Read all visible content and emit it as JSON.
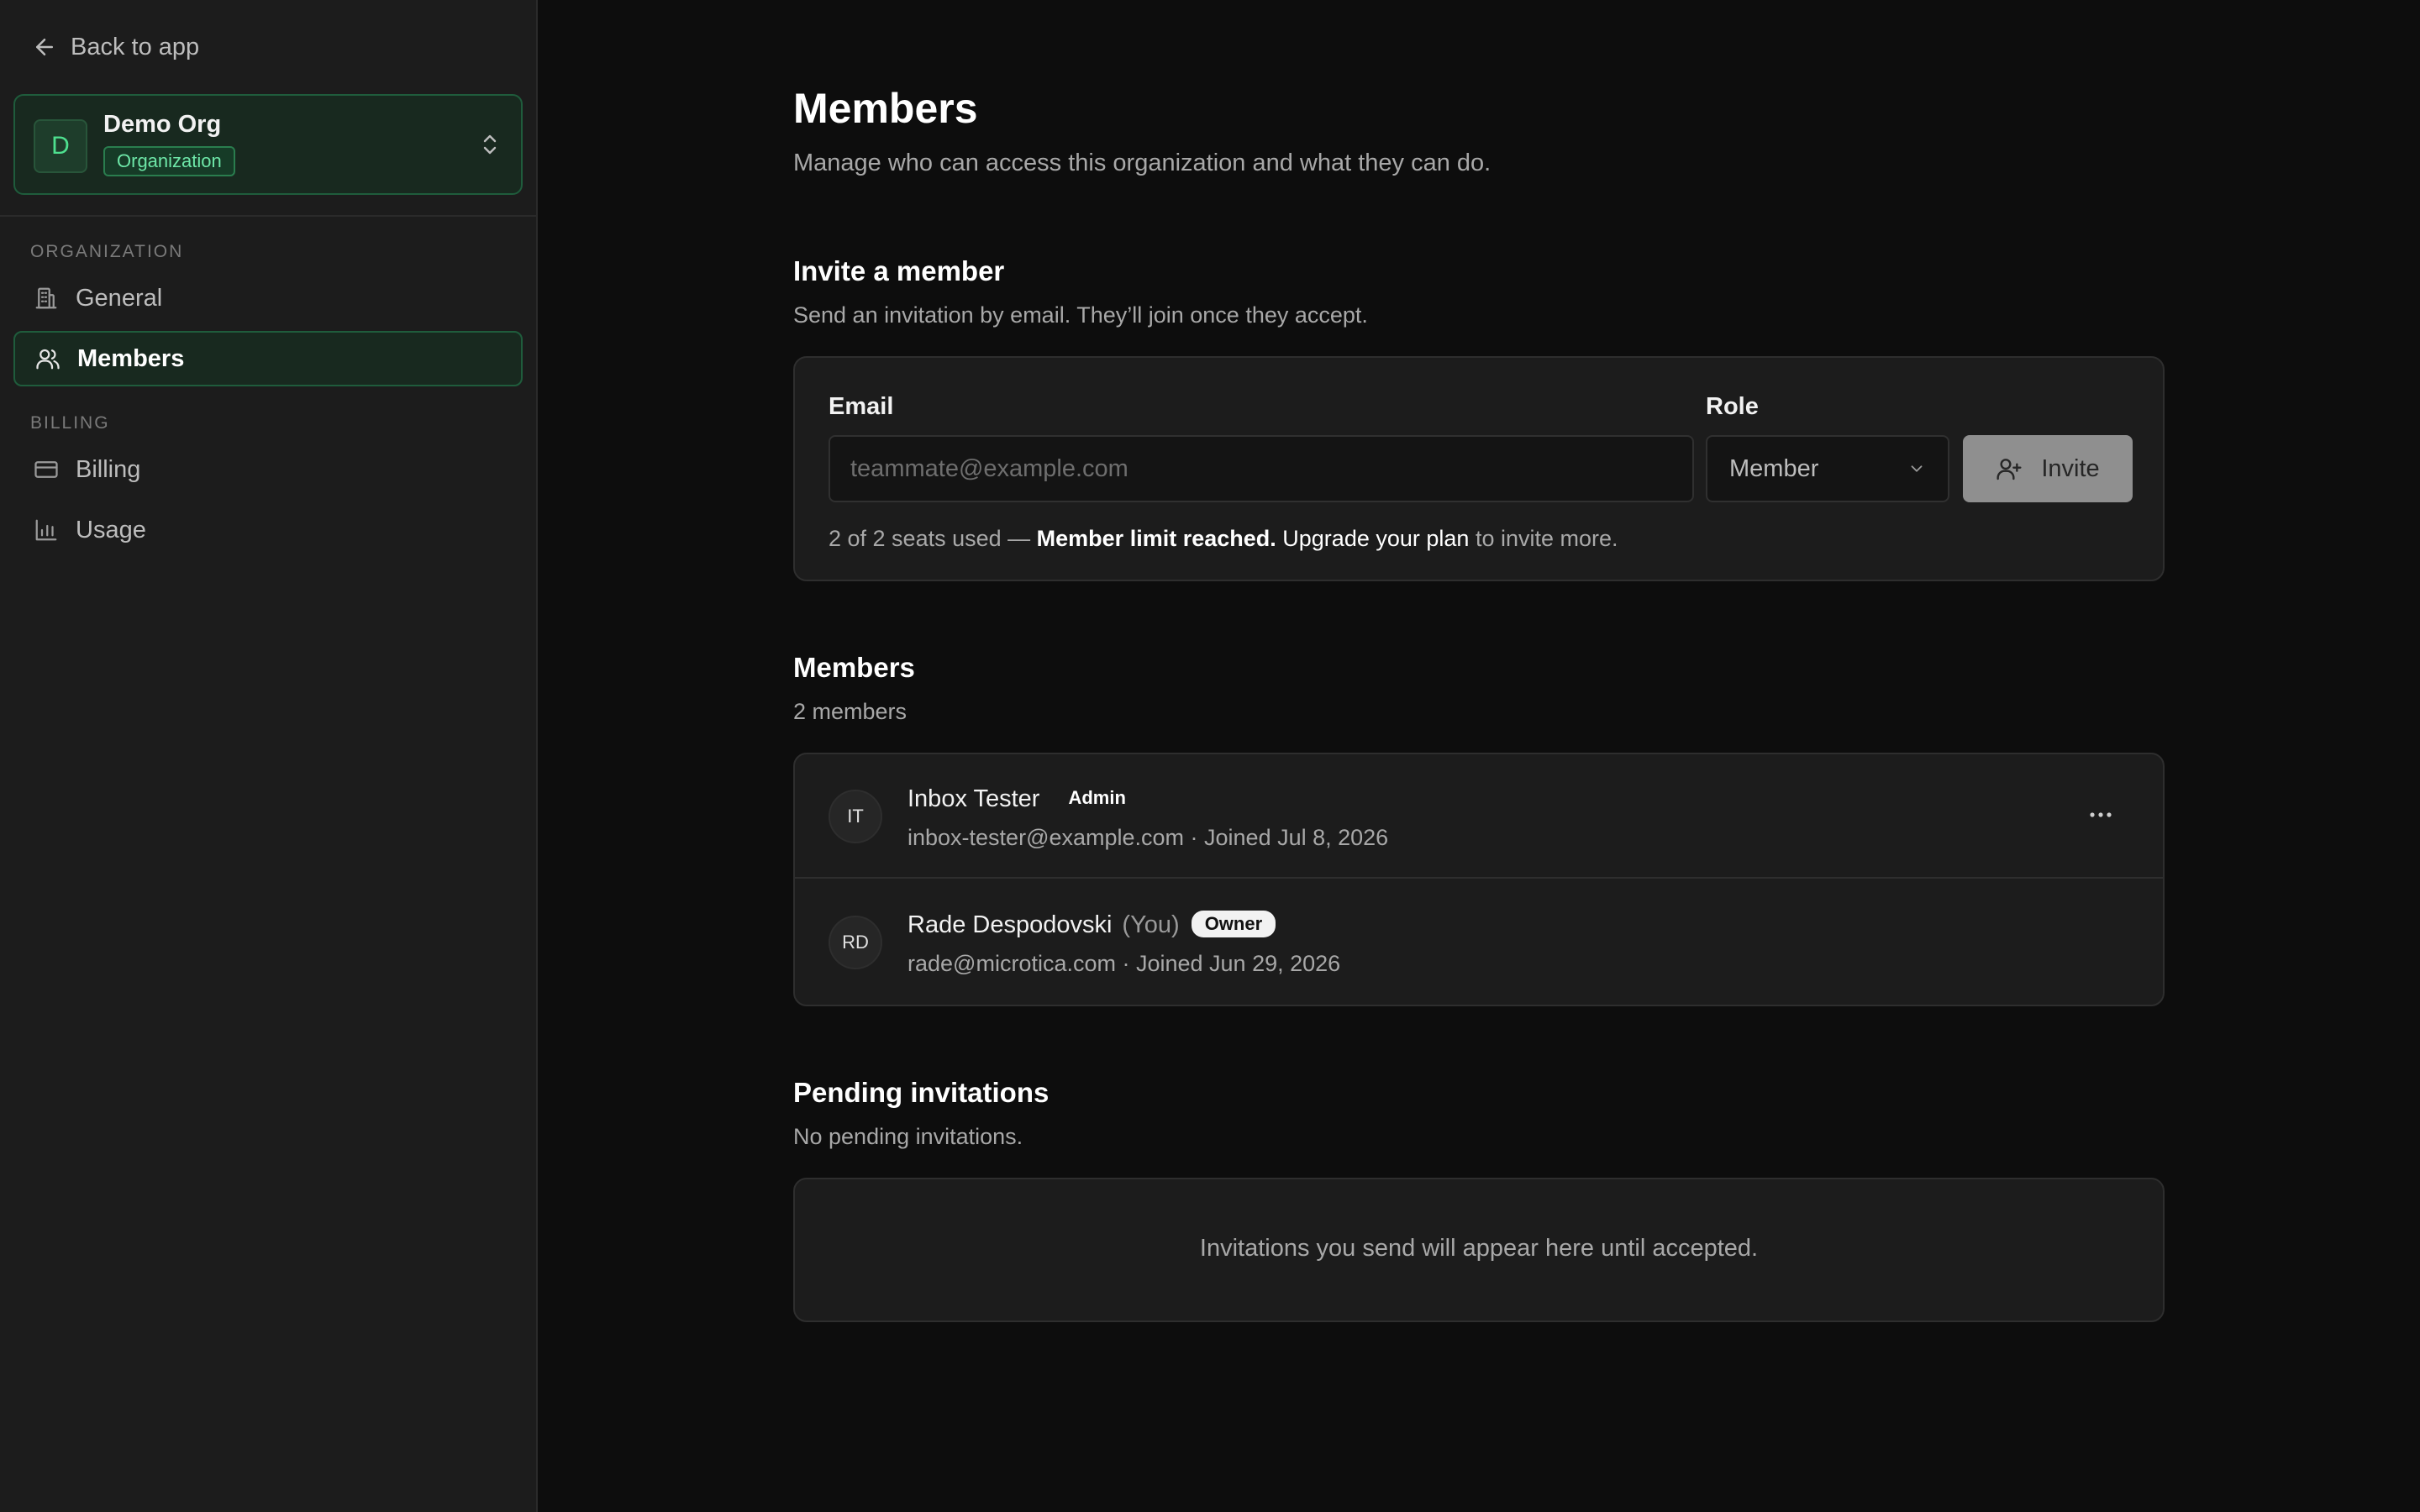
{
  "sidebar": {
    "back_label": "Back to app",
    "org": {
      "initial": "D",
      "name": "Demo Org",
      "badge": "Organization"
    },
    "sections": [
      {
        "label": "ORGANIZATION",
        "items": [
          {
            "label": "General",
            "icon": "building-icon"
          },
          {
            "label": "Members",
            "icon": "users-icon",
            "active": true
          }
        ]
      },
      {
        "label": "BILLING",
        "items": [
          {
            "label": "Billing",
            "icon": "credit-card-icon"
          },
          {
            "label": "Usage",
            "icon": "bar-chart-icon"
          }
        ]
      }
    ]
  },
  "main": {
    "title": "Members",
    "subtitle": "Manage who can access this organization and what they can do.",
    "invite": {
      "title": "Invite a member",
      "subtitle": "Send an invitation by email. They’ll join once they accept.",
      "email_label": "Email",
      "email_placeholder": "teammate@example.com",
      "email_value": "",
      "role_label": "Role",
      "role_value": "Member",
      "button_label": "Invite",
      "seats_used_text": "2 of 2 seats used —",
      "limit_text": "Member limit reached.",
      "upgrade_link": "Upgrade your plan",
      "seats_suffix": "to invite more."
    },
    "members": {
      "title": "Members",
      "count_text": "2 members",
      "rows": [
        {
          "initials": "IT",
          "name": "Inbox Tester",
          "you": "",
          "role": "Admin",
          "meta": "inbox-tester@example.com · Joined Jul 8, 2026"
        },
        {
          "initials": "RD",
          "name": "Rade Despodovski",
          "you": "(You)",
          "role": "Owner",
          "meta": "rade@microtica.com · Joined Jun 29, 2026"
        }
      ]
    },
    "pending": {
      "title": "Pending invitations",
      "subtitle": "No pending invitations.",
      "empty_text": "Invitations you send will appear here until accepted."
    }
  }
}
